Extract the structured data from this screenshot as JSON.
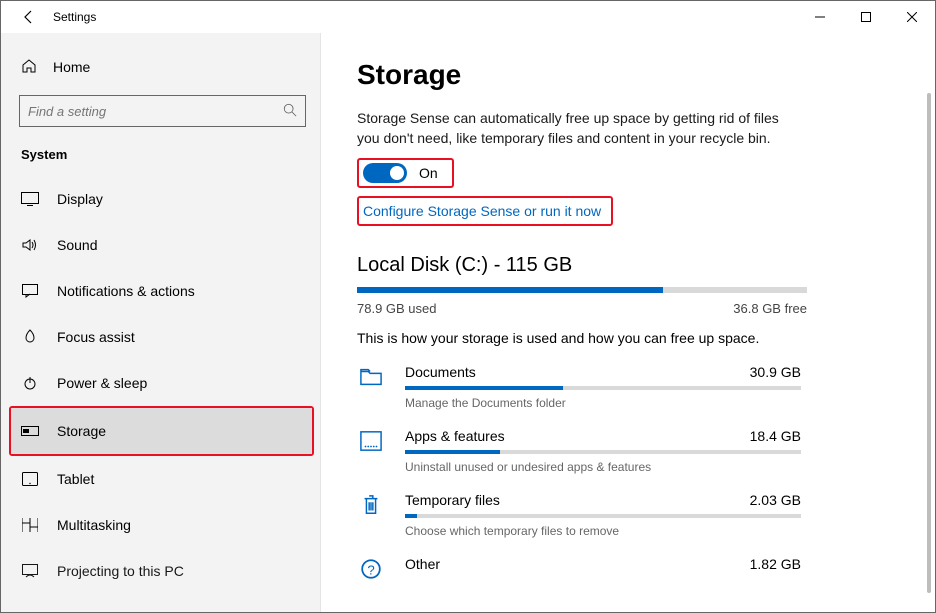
{
  "window": {
    "title": "Settings"
  },
  "sidebar": {
    "home": "Home",
    "search_placeholder": "Find a setting",
    "category": "System",
    "items": [
      {
        "label": "Display"
      },
      {
        "label": "Sound"
      },
      {
        "label": "Notifications & actions"
      },
      {
        "label": "Focus assist"
      },
      {
        "label": "Power & sleep"
      },
      {
        "label": "Storage"
      },
      {
        "label": "Tablet"
      },
      {
        "label": "Multitasking"
      },
      {
        "label": "Projecting to this PC"
      }
    ]
  },
  "page": {
    "title": "Storage",
    "sense_desc": "Storage Sense can automatically free up space by getting rid of files you don't need, like temporary files and content in your recycle bin.",
    "toggle_label": "On",
    "config_link": "Configure Storage Sense or run it now",
    "disk_title": "Local Disk (C:) - 115 GB",
    "used_label": "78.9 GB used",
    "free_label": "36.8 GB free",
    "usage_desc": "This is how your storage is used and how you can free up space.",
    "categories": [
      {
        "name": "Documents",
        "size": "30.9 GB",
        "hint": "Manage the Documents folder",
        "fill_pct": 40
      },
      {
        "name": "Apps & features",
        "size": "18.4 GB",
        "hint": "Uninstall unused or undesired apps & features",
        "fill_pct": 24
      },
      {
        "name": "Temporary files",
        "size": "2.03 GB",
        "hint": "Choose which temporary files to remove",
        "fill_pct": 3
      },
      {
        "name": "Other",
        "size": "1.82 GB",
        "hint": "",
        "fill_pct": 2
      }
    ]
  }
}
